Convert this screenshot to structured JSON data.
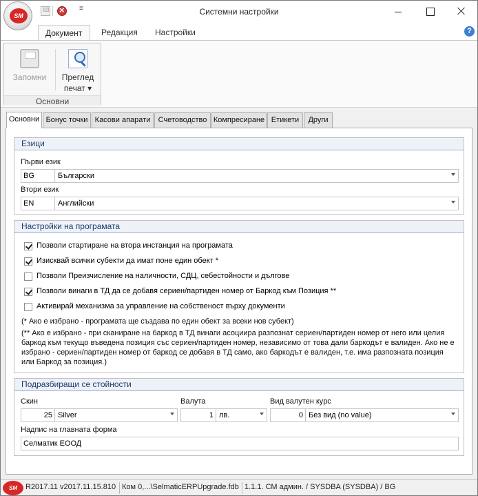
{
  "window": {
    "title": "Системни настройки"
  },
  "logo": {
    "text": "SM"
  },
  "ribbon": {
    "tabs": [
      "Документ",
      "Редакция",
      "Настройки"
    ],
    "group_label": "Основни",
    "save_label": "Запомни",
    "preview_label_1": "Преглед",
    "preview_label_2": "печат ▾"
  },
  "tabs": [
    "Основни",
    "Бонус точки",
    "Касови апарати",
    "Счетоводство",
    "Компресиране",
    "Етикети",
    "Други"
  ],
  "languages": {
    "header": "Езици",
    "first_label": "Първи език",
    "first_code": "BG",
    "first_value": "Български",
    "second_label": "Втори език",
    "second_code": "EN",
    "second_value": "Английски"
  },
  "program_settings": {
    "header": "Настройки на програмата",
    "checkboxes": [
      {
        "label": "Позволи стартиране на втора инстанция на програмата",
        "checked": true
      },
      {
        "label": "Изисквай всички субекти да имат поне един обект *",
        "checked": true
      },
      {
        "label": "Позволи Преизчисление на наличности, СДЦ, себестойности и дългове",
        "checked": false
      },
      {
        "label": "Позволи винаги в ТД да се добавя сериен/партиден номер от Баркод към Позиция **",
        "checked": true
      },
      {
        "label": "Активирай механизма за управление на собственост върху документи",
        "checked": false
      }
    ],
    "note1": "(* Ако е избрано - програмата ще създава по един обект за всеки нов субект)",
    "note2_lines": [
      "(** Ако е избрано - при сканиране на баркод в ТД винаги асоциира разпознат сериен/партиден номер от него или целия",
      "баркод към текущо въведена позиция със сериен/партиден номер, независимо от това дали баркодът е валиден. Ако не е",
      "избрано - сериен/партиден номер от баркод се добавя в ТД само, ако баркодът е валиден, т.е. има разпозната позиция",
      "или Баркод за позиция.)"
    ]
  },
  "defaults": {
    "header": "Подразбиращи се стойности",
    "skin_label": "Скин",
    "skin_num": "25",
    "skin_value": "Silver",
    "currency_label": "Валута",
    "currency_num": "1",
    "currency_value": "лв.",
    "rate_label": "Вид валутен курс",
    "rate_num": "0",
    "rate_value": "Без вид (no value)",
    "caption_label": "Надпис на главната форма",
    "caption_value": "Селматик ЕООД"
  },
  "statusbar": {
    "version": "R2017.11 v2017.11.15.810",
    "db": "Ком 0,...\\SelmaticERPUpgrade.fdb",
    "user": "1.1.1. СМ админ. / SYSDBA (SYSDBA) / BG"
  },
  "colors": {
    "accent_red": "#d72727",
    "group_header_bg": "#eef2f8",
    "group_header_text": "#1a3a6b"
  }
}
